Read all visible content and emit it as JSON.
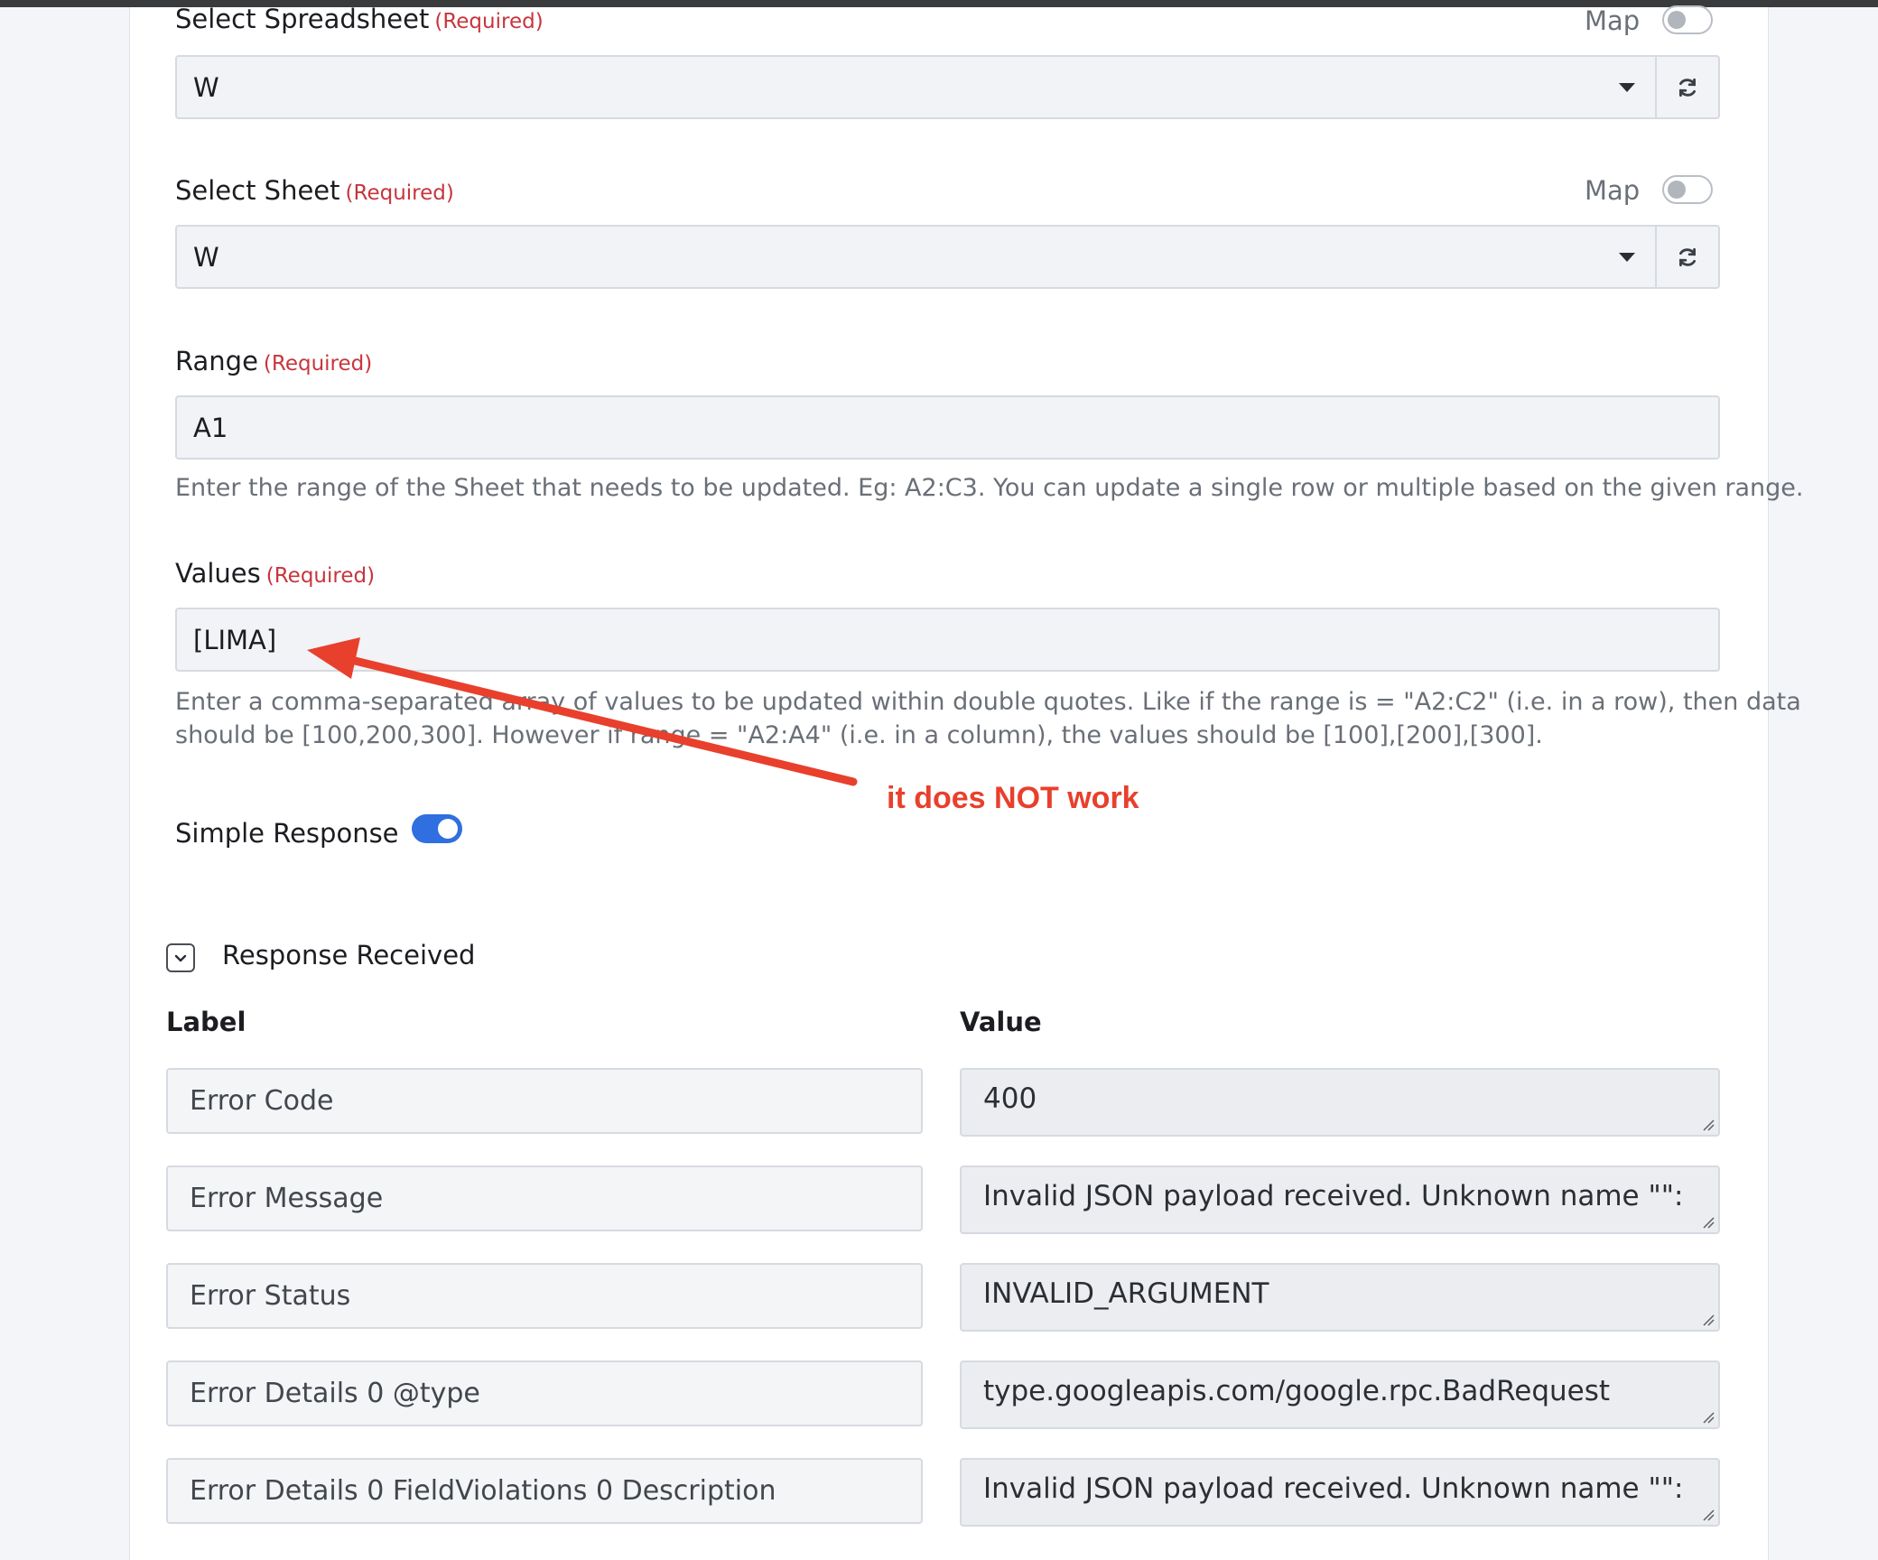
{
  "spreadsheet": {
    "label": "Select Spreadsheet",
    "required": "(Required)",
    "map_label": "Map",
    "value": "W"
  },
  "sheet": {
    "label": "Select Sheet",
    "required": "(Required)",
    "map_label": "Map",
    "value": "W"
  },
  "range": {
    "label": "Range",
    "required": "(Required)",
    "value": "A1",
    "help": "Enter the range of the Sheet that needs to be updated. Eg: A2:C3. You can update a single row or multiple based on the given range."
  },
  "values": {
    "label": "Values",
    "required": "(Required)",
    "value": "[LIMA]",
    "help_line1": "Enter a comma-separated array of values to be updated within double quotes. Like if the range is = \"A2:C2\" (i.e. in a row), then data",
    "help_line2": "should be [100,200,300]. However if range = \"A2:A4\" (i.e. in a column), the values should be [100],[200],[300]."
  },
  "annotation": {
    "text": "it does NOT work",
    "color": "#e8402c"
  },
  "simple_response": {
    "label": "Simple Response",
    "enabled": true
  },
  "response": {
    "title": "Response Received",
    "label_header": "Label",
    "value_header": "Value",
    "rows": [
      {
        "label": "Error Code",
        "value": "400"
      },
      {
        "label": "Error Message",
        "value": "Invalid JSON payload received. Unknown name \"\":"
      },
      {
        "label": "Error Status",
        "value": "INVALID_ARGUMENT"
      },
      {
        "label": "Error Details 0 @type",
        "value": "type.googleapis.com/google.rpc.BadRequest"
      },
      {
        "label": "Error Details 0 FieldViolations 0 Description",
        "value": "Invalid JSON payload received. Unknown name \"\":"
      }
    ]
  },
  "colors": {
    "accent": "#2f6fe0",
    "required": "#c8353d"
  },
  "icons": {
    "refresh": "refresh-icon",
    "caret": "caret-down-icon",
    "chevron": "chevron-down-icon"
  }
}
